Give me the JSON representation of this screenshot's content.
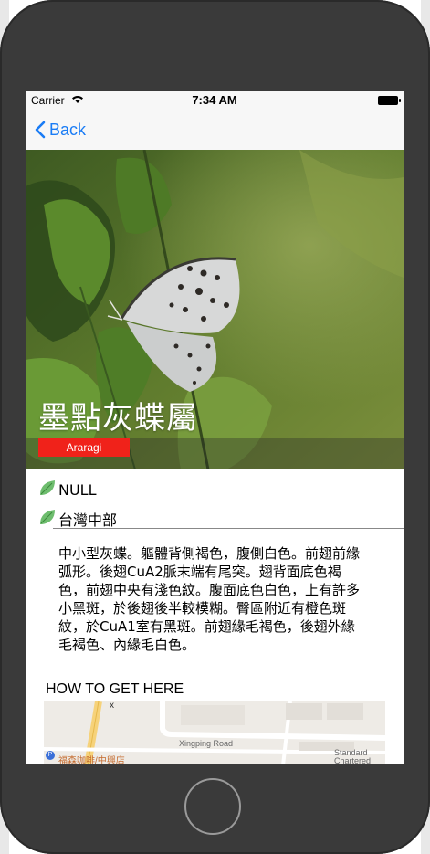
{
  "status_bar": {
    "carrier": "Carrier",
    "time": "7:34 AM"
  },
  "nav": {
    "back_label": "Back"
  },
  "hero": {
    "title": "墨點灰蝶屬",
    "tag": "Araragi"
  },
  "info": [
    {
      "text": "NULL"
    },
    {
      "text": "台灣中部"
    }
  ],
  "description": "中小型灰蝶。軀體背側褐色，腹側白色。前翅前緣弧形。後翅CuA2脈末端有尾突。翅背面底色褐色，前翅中央有淺色紋。腹面底色白色，上有許多小黑斑，於後翅後半較模糊。臀區附近有橙色斑紋，於CuA1室有黑斑。前翅緣毛褐色，後翅外緣毛褐色、內緣毛白色。",
  "how_to_get_here": "HOW TO GET HERE",
  "map": {
    "road_label": "Xingping Road",
    "poi_label": "福森咖啡/中興店",
    "bank_label": "Standard Chartered",
    "marker": "P",
    "street_x": "x"
  },
  "colors": {
    "accent": "#1a7cf5",
    "tag": "#f0221a",
    "leaf": "#6ebd6e"
  }
}
